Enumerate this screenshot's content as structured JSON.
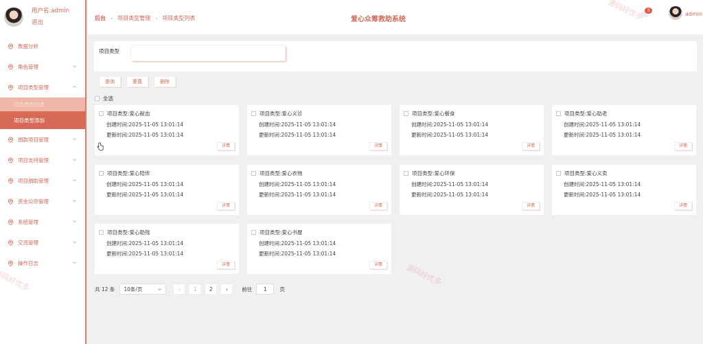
{
  "sidebar": {
    "username": "用户名:admin",
    "logout": "退出",
    "menu": [
      {
        "label": "数据分析",
        "chevron": false
      },
      {
        "label": "角色管理",
        "chevron": "down"
      },
      {
        "label": "项目类型管理",
        "chevron": "up"
      },
      {
        "label": "捐款项目管理",
        "chevron": "down"
      },
      {
        "label": "项目支持管理",
        "chevron": "down"
      },
      {
        "label": "项目捐助管理",
        "chevron": "down"
      },
      {
        "label": "资金公示管理",
        "chevron": "down"
      },
      {
        "label": "系统管理",
        "chevron": "down"
      },
      {
        "label": "交流管理",
        "chevron": "down"
      },
      {
        "label": "操作日志",
        "chevron": "down"
      }
    ],
    "submenu": [
      {
        "label": "项目类型列表"
      },
      {
        "label": "项目类型添加"
      }
    ]
  },
  "header": {
    "breadcrumb": [
      "后台",
      "项目类型管理",
      "项目类型列表"
    ],
    "system_title": "爱心众筹救助系统",
    "notification_count": "3",
    "user": "admin"
  },
  "search": {
    "label": "项目类型",
    "value": ""
  },
  "actions": {
    "query": "查询",
    "reset": "重置",
    "delete": "删除",
    "select_all": "全选"
  },
  "labels": {
    "type": "项目类型:",
    "created": "创建时间:",
    "updated": "更新时间:",
    "detail": "详情"
  },
  "cards": [
    {
      "type": "爱心献血",
      "created": "2025-11-05 13:01:14",
      "updated": "2025-11-05 13:01:14"
    },
    {
      "type": "爱心义诊",
      "created": "2025-11-05 13:01:14",
      "updated": "2025-11-05 13:01:14"
    },
    {
      "type": "爱心餐食",
      "created": "2025-11-05 13:01:14",
      "updated": "2025-11-05 13:01:14"
    },
    {
      "type": "爱心助老",
      "created": "2025-11-05 13:01:14",
      "updated": "2025-11-05 13:01:14"
    },
    {
      "type": "爱心陪伴",
      "created": "2025-11-05 13:01:14",
      "updated": "2025-11-05 13:01:14"
    },
    {
      "type": "爱心衣物",
      "created": "2025-11-05 13:01:14",
      "updated": "2025-11-05 13:01:14"
    },
    {
      "type": "爱心环保",
      "created": "2025-11-05 13:01:14",
      "updated": "2025-11-05 13:01:14"
    },
    {
      "type": "爱心义卖",
      "created": "2025-11-05 13:01:14",
      "updated": "2025-11-05 13:01:14"
    },
    {
      "type": "爱心助残",
      "created": "2025-11-05 13:01:14",
      "updated": "2025-11-05 13:01:14"
    },
    {
      "type": "爱心书屋",
      "created": "2025-11-05 13:01:14",
      "updated": "2025-11-05 13:01:14"
    }
  ],
  "pagination": {
    "total": "共 12 条",
    "page_size": "10条/页",
    "page1": "1",
    "page2": "2",
    "goto_label": "前往",
    "goto_value": "1",
    "page_suffix": "页"
  },
  "watermark": "源码好优多",
  "colors": {
    "accent": "#d06a58",
    "active_menu": "#d76a57",
    "submenu_light": "#f0b6aa",
    "background": "#f0f0f3"
  }
}
